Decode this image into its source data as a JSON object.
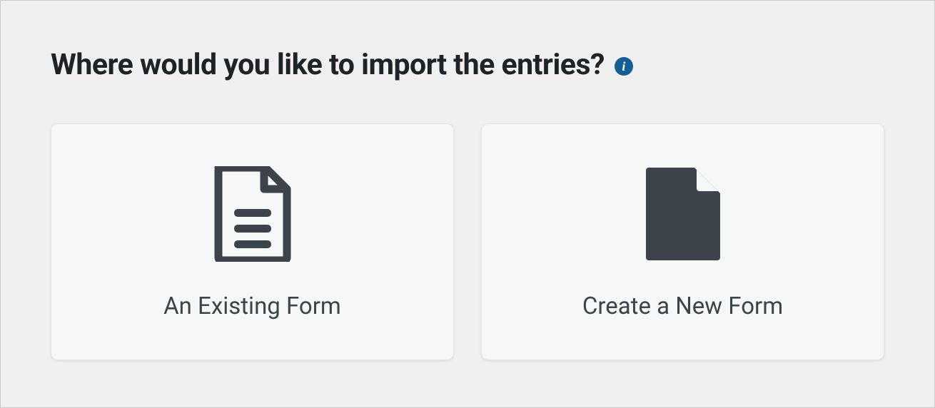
{
  "heading": "Where would you like to import the entries?",
  "info_tooltip_char": "i",
  "options": {
    "existing": {
      "label": "An Existing Form",
      "icon_name": "document-lines-icon"
    },
    "new": {
      "label": "Create a New Form",
      "icon_name": "document-blank-icon"
    }
  },
  "colors": {
    "icon": "#3c434a",
    "info_bg": "#135e96",
    "card_bg": "#f6f7f7",
    "page_bg": "#f0f0f1"
  }
}
